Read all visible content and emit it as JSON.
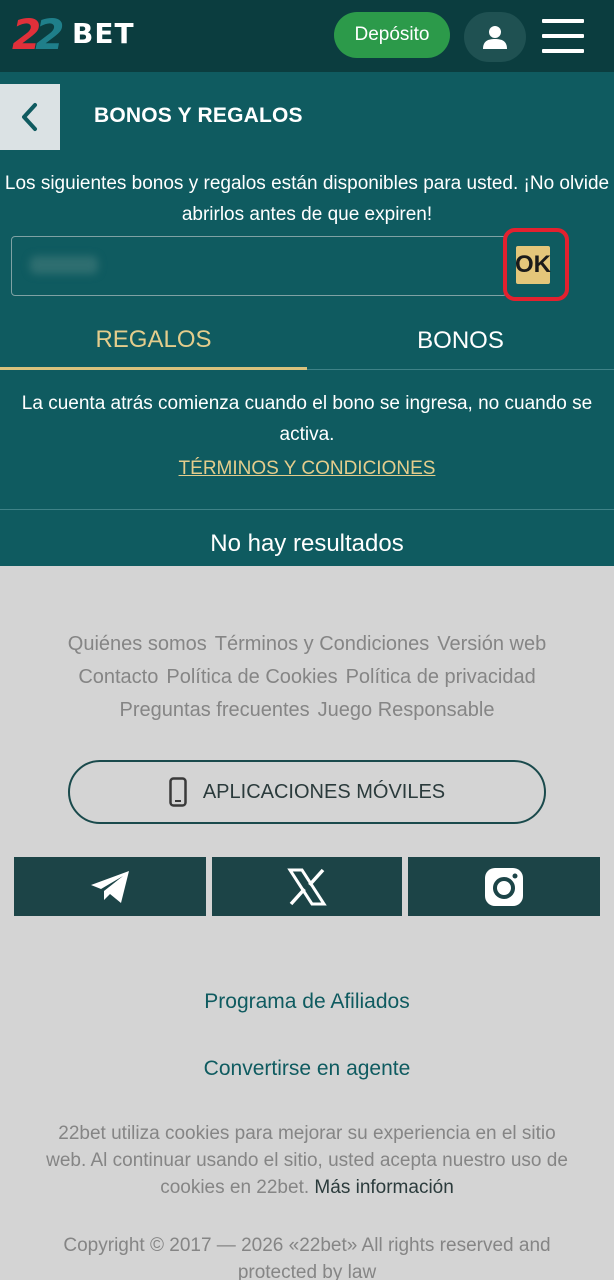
{
  "header": {
    "logo_digits": "22",
    "logo_text": "BET",
    "deposit_label": "Depósito",
    "user_icon": "user-icon",
    "menu_icon": "hamburger-menu-icon"
  },
  "page": {
    "back_icon": "chevron-left-icon",
    "title": "BONOS Y REGALOS",
    "intro": "Los siguientes bonos y regalos están disponibles para usted. ¡No olvide abrirlos antes de que expiren!",
    "ok_label": "OK"
  },
  "tabs": [
    {
      "label": "REGALOS",
      "active": true
    },
    {
      "label": "BONOS",
      "active": false
    }
  ],
  "content": {
    "countdown_note": "La cuenta atrás comienza cuando el bono se ingresa, no cuando se activa.",
    "terms_link": "TÉRMINOS Y CONDICIONES",
    "empty_state": "No hay resultados"
  },
  "footer": {
    "links": [
      "Quiénes somos",
      "Términos y Condiciones",
      "Versión web",
      "Contacto",
      "Política de Cookies",
      "Política de privacidad",
      "Preguntas frecuentes",
      "Juego Responsable"
    ],
    "apps_label": "APLICACIONES MÓVILES",
    "social": [
      "telegram-icon",
      "x-icon",
      "instagram-icon"
    ],
    "affiliate": "Programa de Afiliados",
    "agent": "Convertirse en agente",
    "cookies_text": "22bet utiliza cookies para mejorar su experiencia en el sitio web. Al continuar usando el sitio, usted acepta nuestro uso de cookies en 22bet.",
    "cookies_more": "Más información",
    "copyright": "Copyright © 2017 — 2026 «22bet» All rights reserved and protected by law"
  },
  "colors": {
    "header_bg": "#0b3d3f",
    "panel_bg": "#0f5b60",
    "accent_gold": "#e4cd8c",
    "deposit_green": "#2c9a4a",
    "highlight_red": "#e3212f",
    "footer_bg": "#d4d4d4"
  }
}
